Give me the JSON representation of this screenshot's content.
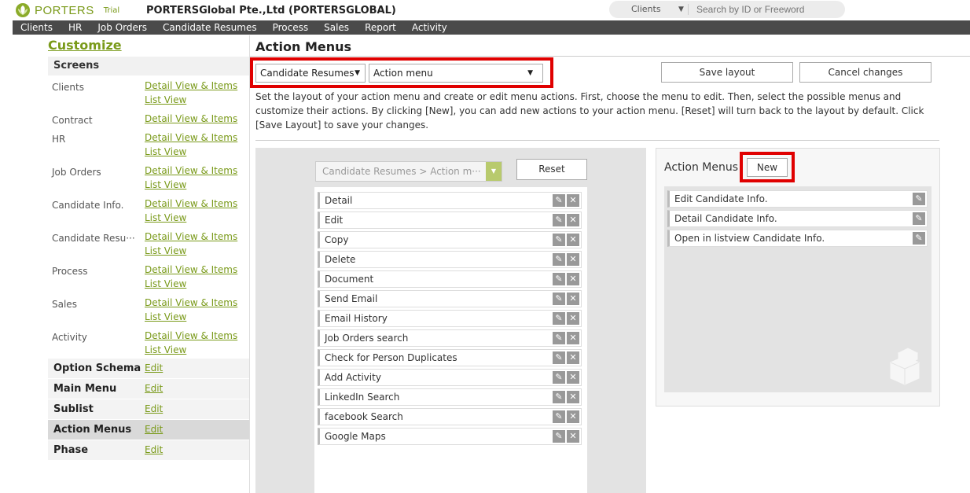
{
  "header": {
    "brand": "PORTERS",
    "trial_label": "Trial",
    "company": "PORTERSGlobal Pte.,Ltd (PORTERSGLOBAL)",
    "search_scope": "Clients",
    "search_placeholder": "Search by ID or Freeword"
  },
  "nav": [
    "Clients",
    "HR",
    "Job Orders",
    "Candidate Resumes",
    "Process",
    "Sales",
    "Report",
    "Activity"
  ],
  "sidebar": {
    "title": "Customize",
    "screens_heading": "Screens",
    "screens": [
      {
        "name": "Clients",
        "links": [
          "Detail View & Items",
          "List View"
        ]
      },
      {
        "name": "Contract",
        "links": [
          "Detail View & Items"
        ]
      },
      {
        "name": "HR",
        "links": [
          "Detail View & Items",
          "List View"
        ]
      },
      {
        "name": "Job Orders",
        "links": [
          "Detail View & Items",
          "List View"
        ]
      },
      {
        "name": "Candidate Info.",
        "links": [
          "Detail View & Items",
          "List View"
        ]
      },
      {
        "name": "Candidate Resu···",
        "links": [
          "Detail View & Items",
          "List View"
        ]
      },
      {
        "name": "Process",
        "links": [
          "Detail View & Items",
          "List View"
        ]
      },
      {
        "name": "Sales",
        "links": [
          "Detail View & Items",
          "List View"
        ]
      },
      {
        "name": "Activity",
        "links": [
          "Detail View & Items",
          "List View"
        ]
      }
    ],
    "sections": [
      {
        "name": "Option Schema",
        "link": "Edit"
      },
      {
        "name": "Main Menu",
        "link": "Edit"
      },
      {
        "name": "Sublist",
        "link": "Edit"
      },
      {
        "name": "Action Menus",
        "link": "Edit",
        "active": true
      },
      {
        "name": "Phase",
        "link": "Edit"
      }
    ]
  },
  "main": {
    "title": "Action Menus",
    "screen_select": "Candidate Resumes",
    "menu_select": "Action menu",
    "save_layout": "Save layout",
    "cancel_changes": "Cancel changes",
    "description": "Set the layout of your action menu and create or edit menu actions. First, choose the menu to edit. Then, select the possible menus and customize their actions. By clicking [New], you can add new actions to your action menu. [Reset] will turn back to the layout by default. Click [Save Layout] to save your changes."
  },
  "editor": {
    "breadcrumb": "Candidate Resumes > Action m···",
    "reset": "Reset",
    "items": [
      "Detail",
      "Edit",
      "Copy",
      "Delete",
      "Document",
      "Send Email",
      "Email History",
      "Job Orders search",
      "Check for Person Duplicates",
      "Add Activity",
      "LinkedIn Search",
      "facebook Search",
      "Google Maps"
    ]
  },
  "action_menus": {
    "label": "Action Menus",
    "new_button": "New",
    "items": [
      "Edit Candidate Info.",
      "Detail Candidate Info.",
      "Open in listview Candidate Info."
    ]
  },
  "colors": {
    "accent": "#7a9a1a",
    "nav_bg": "#4a4a4a",
    "highlight": "#e00000"
  }
}
